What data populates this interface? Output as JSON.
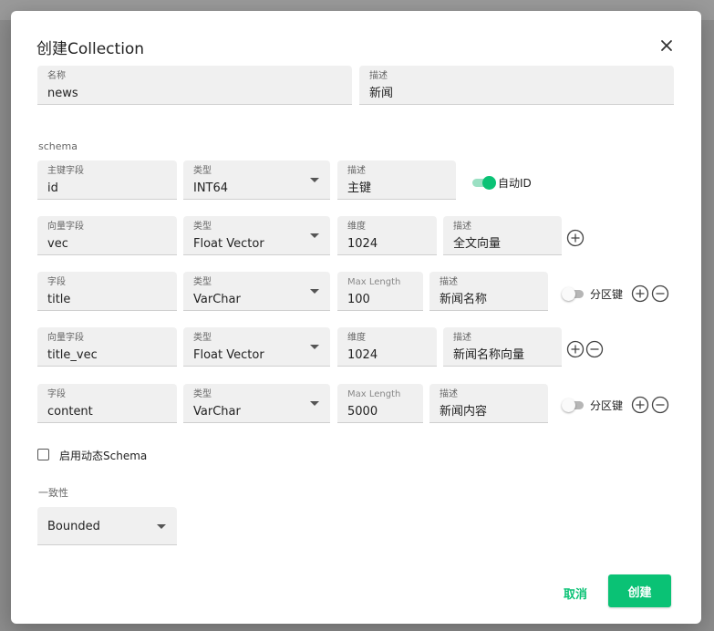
{
  "dialog": {
    "title": "创建Collection",
    "name": {
      "label": "名称",
      "value": "news"
    },
    "description": {
      "label": "描述",
      "value": "新闻"
    }
  },
  "schema_label": "schema",
  "fields": [
    {
      "name_label": "主键字段",
      "name_value": "id",
      "type_label": "类型",
      "type_value": "INT64",
      "desc_label": "描述",
      "desc_value": "主键",
      "toggle_label": "自动ID",
      "toggle_on": true
    },
    {
      "name_label": "向量字段",
      "name_value": "vec",
      "type_label": "类型",
      "type_value": "Float Vector",
      "dim_label": "维度",
      "dim_value": "1024",
      "desc_label": "描述",
      "desc_value": "全文向量"
    },
    {
      "name_label": "字段",
      "name_value": "title",
      "type_label": "类型",
      "type_value": "VarChar",
      "maxlen_label": "Max Length",
      "maxlen_value": "100",
      "desc_label": "描述",
      "desc_value": "新闻名称",
      "toggle_label": "分区键",
      "toggle_on": false
    },
    {
      "name_label": "向量字段",
      "name_value": "title_vec",
      "type_label": "类型",
      "type_value": "Float Vector",
      "dim_label": "维度",
      "dim_value": "1024",
      "desc_label": "描述",
      "desc_value": "新闻名称向量"
    },
    {
      "name_label": "字段",
      "name_value": "content",
      "type_label": "类型",
      "type_value": "VarChar",
      "maxlen_label": "Max Length",
      "maxlen_value": "5000",
      "desc_label": "描述",
      "desc_value": "新闻内容",
      "toggle_label": "分区键",
      "toggle_on": false
    }
  ],
  "dynamic_schema": {
    "label": "启用动态Schema",
    "checked": false
  },
  "consistency": {
    "label": "一致性",
    "value": "Bounded"
  },
  "buttons": {
    "cancel": "取消",
    "create": "创建"
  },
  "colors": {
    "accent": "#0ac275"
  },
  "icons": {
    "close": "close-icon",
    "add": "add-circle-icon",
    "remove": "remove-circle-icon",
    "dropdown": "chevron-down-icon"
  }
}
